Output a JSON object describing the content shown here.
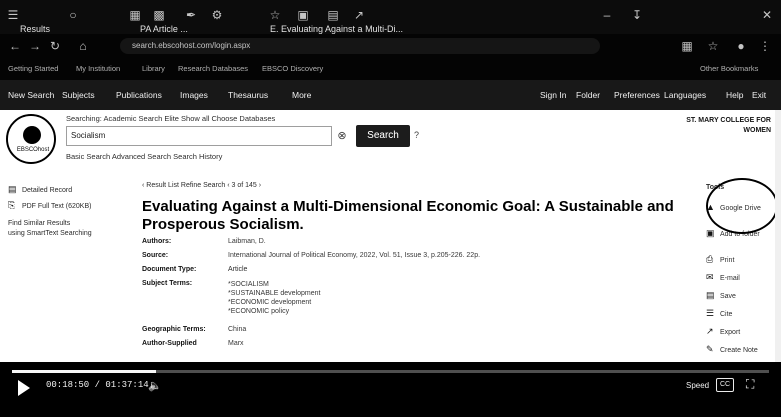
{
  "tabbar": {
    "tabs": [
      {
        "label": "Results"
      },
      {
        "label": "PA Article ..."
      },
      {
        "label": "E. Evaluating Against a Multi-Di..."
      }
    ]
  },
  "address": {
    "url": "search.ebscohost.com/login.aspx"
  },
  "bookmarks": [
    "Getting Started",
    "My Institution",
    "Library",
    "Research Databases",
    "EBSCO Discovery",
    "Other Bookmarks"
  ],
  "sitenav": {
    "left": [
      "New Search",
      "Subjects",
      "Publications",
      "Images",
      "Thesaurus",
      "More"
    ],
    "right": [
      "Sign In",
      "Folder",
      "Preferences",
      "Languages",
      "Help",
      "Exit"
    ]
  },
  "header": {
    "logo_text": "EBSCOhost",
    "searching_line": "Searching: Academic Search Elite  Show all  Choose Databases",
    "search_value": "Socialism",
    "search_button": "Search",
    "help_glyph": "?",
    "links": "Basic Search   Advanced Search   Search History",
    "institution": "ST. MARY COLLEGE FOR WOMEN"
  },
  "leftbar": {
    "items": [
      "Detailed Record",
      "PDF Full Text (620KB)",
      "Find Similar Results",
      "using SmartText Searching"
    ]
  },
  "main": {
    "breadcrumb": "‹ Result List   Refine Search   ‹ 3 of 145 ›",
    "title": "Evaluating Against a Multi-Dimensional Economic Goal: A Sustainable and Prosperous Socialism.",
    "fields": [
      {
        "label": "Authors:",
        "value": "Laibman, D."
      },
      {
        "label": "Source:",
        "value": "International Journal of Political Economy, 2022, Vol. 51, Issue 3, p.205-226. 22p."
      },
      {
        "label": "Document Type:",
        "value": "Article"
      },
      {
        "label": "Subject Terms:",
        "value": "*SOCIALISM\n*SUSTAINABLE development\n*ECONOMIC development\n*ECONOMIC policy"
      },
      {
        "label": "Geographic Terms:",
        "value": "China"
      },
      {
        "label": "Author-Supplied",
        "value": "Marx"
      }
    ]
  },
  "rightbar": {
    "heading": "Tools",
    "items": [
      "Google Drive",
      "Add to folder",
      "Print",
      "E-mail",
      "Save",
      "Cite",
      "Export",
      "Create Note"
    ]
  },
  "video": {
    "time": "00:18:50 / 01:37:14",
    "speed": "Speed",
    "cc": "CC",
    "progress": 0.19
  }
}
